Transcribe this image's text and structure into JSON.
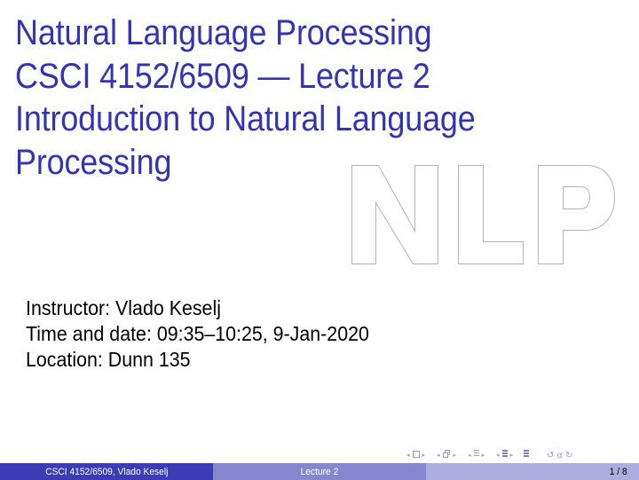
{
  "slide": {
    "title_lines": [
      "Natural Language Processing",
      "CSCI 4152/6509 — Lecture 2",
      "Introduction to Natural Language",
      "Processing"
    ],
    "logo_text": "NLP",
    "info_lines": [
      "Instructor: Vlado Keselj",
      "Time and date: 09:35–10:25, 9-Jan-2020",
      "Location: Dunn 135"
    ],
    "colors": {
      "title": "#3333b3",
      "footer_left": "#3c3cb4",
      "footer_middle": "#8585d0",
      "footer_right": "#adaddf",
      "logo_outline": "#b4b4b4"
    }
  },
  "navigation": {
    "icons": [
      "nav-slide-prev-icon",
      "nav-slide-icon",
      "nav-slide-next-icon",
      "nav-frame-prev-icon",
      "nav-frame-icon",
      "nav-frame-next-icon",
      "nav-subsection-prev-icon",
      "nav-subsection-icon",
      "nav-subsection-next-icon",
      "nav-section-prev-icon",
      "nav-section-icon",
      "nav-section-next-icon",
      "nav-toc-icon",
      "nav-back-icon",
      "nav-search-icon",
      "nav-forward-icon"
    ],
    "arrow_left": "◂",
    "arrow_right": "▸",
    "back_glyph": "↺",
    "search_glyph": "α",
    "forward_glyph": "↻"
  },
  "footer": {
    "left": "CSCI 4152/6509, Vlado Keselj",
    "middle": "Lecture 2",
    "page": "1 / 8"
  }
}
